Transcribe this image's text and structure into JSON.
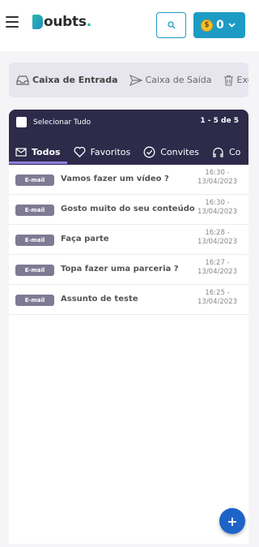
{
  "header": {
    "logo_text": "oubts",
    "logo_dot": ".",
    "coin_value": "0",
    "coin_symbol": "$"
  },
  "folders": [
    {
      "label": "Caixa de Entrada",
      "icon": "inbox-icon",
      "active": true
    },
    {
      "label": "Caixa de Saída",
      "icon": "send-icon",
      "active": false
    },
    {
      "label": "Exc",
      "icon": "trash-icon",
      "active": false
    }
  ],
  "list": {
    "select_all_label": "Selecionar Tudo",
    "range": "1 - 5 de 5",
    "tabs": [
      {
        "label": "Todos",
        "icon": "mail-icon",
        "active": true
      },
      {
        "label": "Favoritos",
        "icon": "heart-icon",
        "active": false
      },
      {
        "label": "Convites",
        "icon": "check-circle-icon",
        "active": false
      },
      {
        "label": "Co",
        "icon": "headset-icon",
        "active": false
      }
    ],
    "messages": [
      {
        "badge": "E-mail",
        "subject": "Vamos fazer um vídeo ?",
        "time": "16:30 -",
        "date": "13/04/2023"
      },
      {
        "badge": "E-mail",
        "subject": "Gosto muito do seu conteúdo",
        "time": "16:30 -",
        "date": "13/04/2023"
      },
      {
        "badge": "E-mail",
        "subject": "Faça parte",
        "time": "16:28 -",
        "date": "13/04/2023"
      },
      {
        "badge": "E-mail",
        "subject": "Topa fazer uma parceria ?",
        "time": "16:27 -",
        "date": "13/04/2023"
      },
      {
        "badge": "E-mail",
        "subject": "Assunto de teste",
        "time": "16:25 -",
        "date": "13/04/2023"
      }
    ]
  },
  "fab_label": "+",
  "colors": {
    "accent": "#1e9bc4",
    "panel_header": "#2d2a4a",
    "tab_underline": "#8f7fe0",
    "fab": "#1e63c8"
  }
}
